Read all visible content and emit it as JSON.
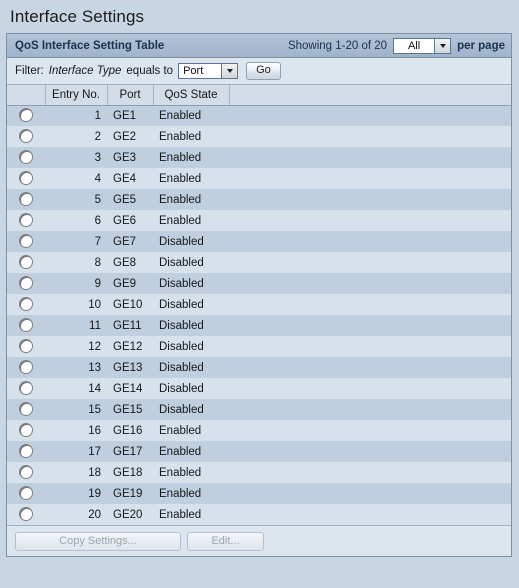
{
  "page": {
    "title": "Interface Settings"
  },
  "panel": {
    "title": "QoS Interface Setting Table",
    "showing_text": "Showing 1-20 of 20",
    "per_page_value": "All",
    "per_page_text": "per page"
  },
  "filter": {
    "label": "Filter:",
    "field_name": "Interface Type",
    "operator": "equals to",
    "value": "Port",
    "go_label": "Go"
  },
  "table": {
    "columns": [
      "",
      "Entry No.",
      "Port",
      "QoS State",
      ""
    ],
    "rows": [
      {
        "entry": "1",
        "port": "GE1",
        "state": "Enabled"
      },
      {
        "entry": "2",
        "port": "GE2",
        "state": "Enabled"
      },
      {
        "entry": "3",
        "port": "GE3",
        "state": "Enabled"
      },
      {
        "entry": "4",
        "port": "GE4",
        "state": "Enabled"
      },
      {
        "entry": "5",
        "port": "GE5",
        "state": "Enabled"
      },
      {
        "entry": "6",
        "port": "GE6",
        "state": "Enabled"
      },
      {
        "entry": "7",
        "port": "GE7",
        "state": "Disabled"
      },
      {
        "entry": "8",
        "port": "GE8",
        "state": "Disabled"
      },
      {
        "entry": "9",
        "port": "GE9",
        "state": "Disabled"
      },
      {
        "entry": "10",
        "port": "GE10",
        "state": "Disabled"
      },
      {
        "entry": "11",
        "port": "GE11",
        "state": "Disabled"
      },
      {
        "entry": "12",
        "port": "GE12",
        "state": "Disabled"
      },
      {
        "entry": "13",
        "port": "GE13",
        "state": "Disabled"
      },
      {
        "entry": "14",
        "port": "GE14",
        "state": "Disabled"
      },
      {
        "entry": "15",
        "port": "GE15",
        "state": "Disabled"
      },
      {
        "entry": "16",
        "port": "GE16",
        "state": "Enabled"
      },
      {
        "entry": "17",
        "port": "GE17",
        "state": "Enabled"
      },
      {
        "entry": "18",
        "port": "GE18",
        "state": "Enabled"
      },
      {
        "entry": "19",
        "port": "GE19",
        "state": "Enabled"
      },
      {
        "entry": "20",
        "port": "GE20",
        "state": "Enabled"
      }
    ]
  },
  "footer": {
    "copy_settings_label": "Copy Settings...",
    "edit_label": "Edit..."
  },
  "colors": {
    "page_background": "#c8d6e4",
    "panel_background": "#dde6ef",
    "panel_header": "#a9bcd1",
    "row_odd": "#bfcfe0",
    "row_even": "#d7e1ec",
    "header_row": "#d4dde7",
    "border": "#7d91a6",
    "text": "#14171a",
    "title_text": "#17334f",
    "disabled_text": "#9aa6b1"
  }
}
